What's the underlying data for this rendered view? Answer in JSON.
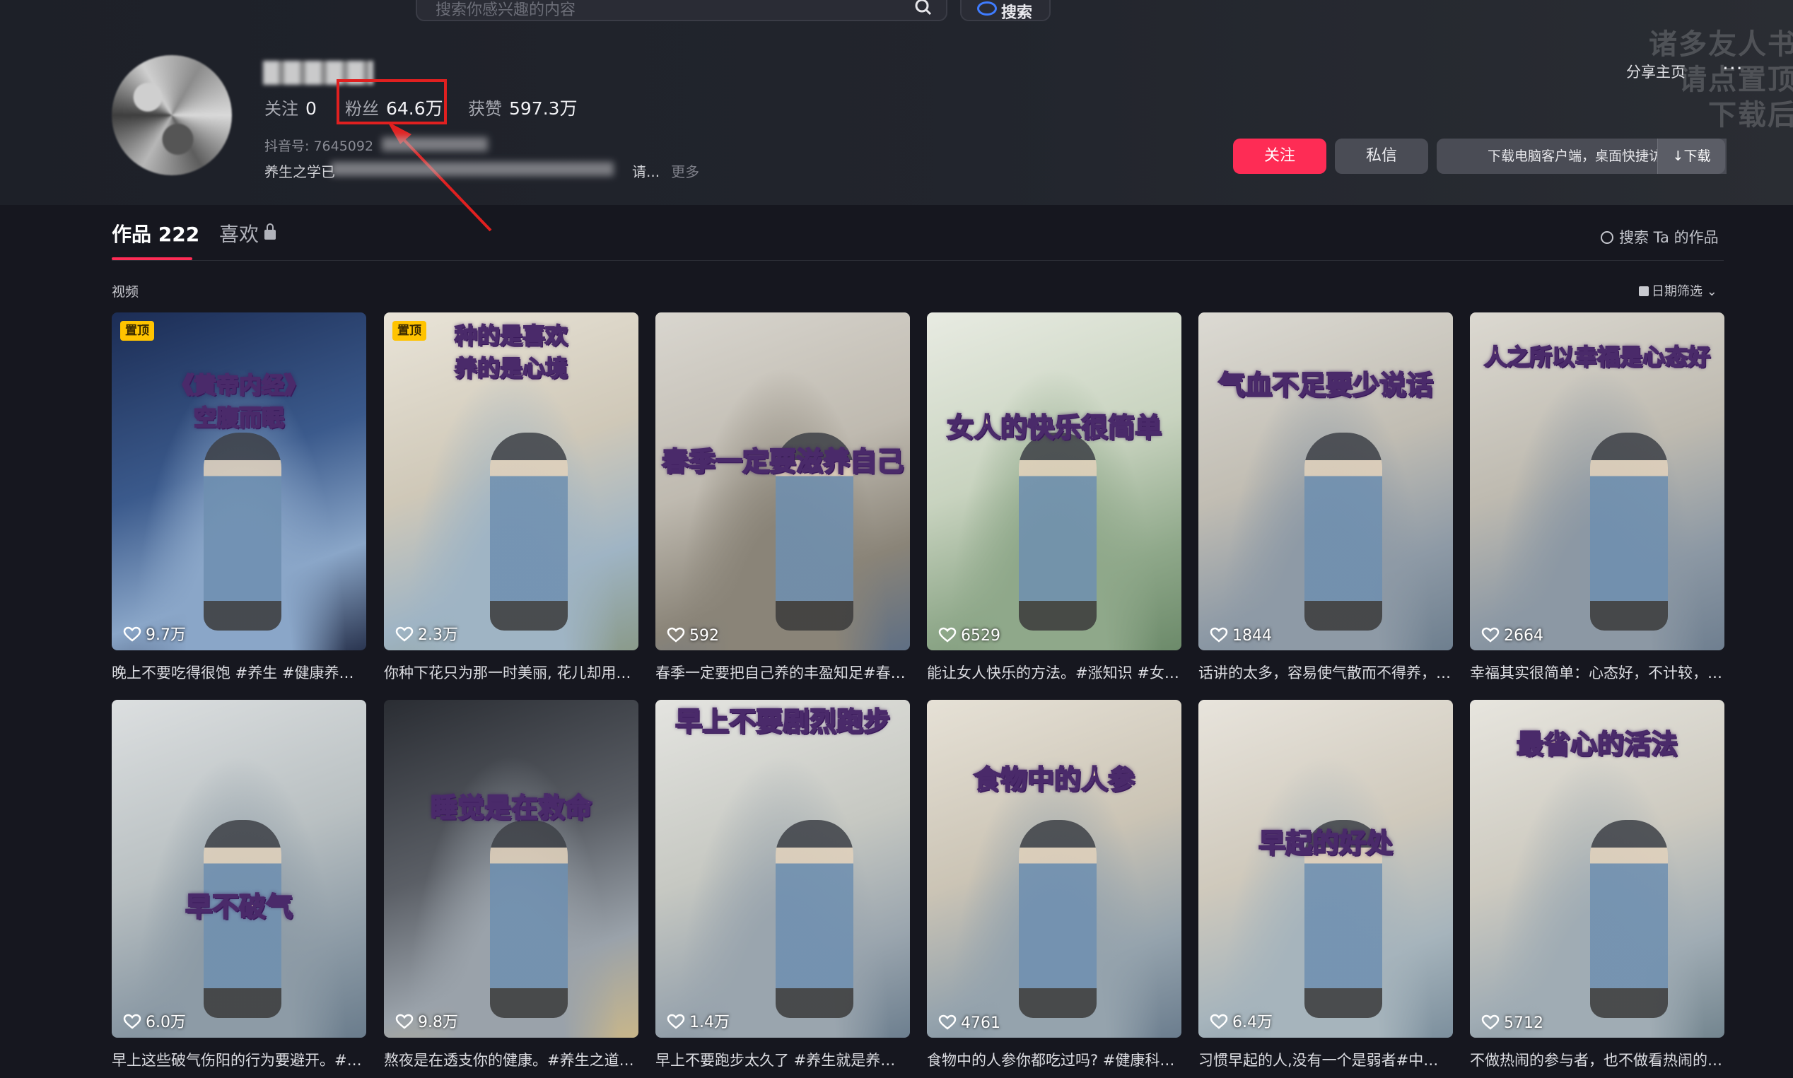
{
  "header": {
    "search_placeholder": "搜索你感兴趣的内容",
    "ai_search_label": "搜索",
    "watermark_lines": [
      "诸多友人书",
      "请点置顶",
      "下载后"
    ],
    "share_label": "分享主页",
    "more_label": "···"
  },
  "profile": {
    "stats": [
      {
        "label": "关注",
        "value": "0"
      },
      {
        "label": "粉丝",
        "value": "64.6万"
      },
      {
        "label": "获赞",
        "value": "597.3万"
      }
    ],
    "douyin_id_label": "抖音号: 7645092",
    "bio_start": "养生之学已",
    "bio_end": "请...",
    "more_label": "更多"
  },
  "actions": {
    "follow": "关注",
    "message": "私信",
    "download_tip": "下载电脑客户端，桌面快捷访问",
    "download": "↓下载"
  },
  "tabs": {
    "works": "作品 222",
    "likes": "喜欢",
    "search_works": "搜索 Ta 的作品",
    "section_label": "视频",
    "date_filter": "日期筛选"
  },
  "videos": [
    {
      "title": "《黄帝内经》\n空腹而眠",
      "likes": "9.7万",
      "pinned": true,
      "caption": "晚上不要吃得很饱 #养生 #健康养生 …"
    },
    {
      "title": "种的是喜欢\n养的是心境",
      "likes": "2.3万",
      "pinned": true,
      "caption": "你种下花只为那一时美丽, 花儿却用…"
    },
    {
      "title": "春季一定要滋养自己",
      "likes": "592",
      "pinned": false,
      "caption": "春季一定要把自己养的丰盈知足#春…"
    },
    {
      "title": "女人的快乐很简单",
      "likes": "6529",
      "pinned": false,
      "caption": "能让女人快乐的方法。#涨知识 #女…"
    },
    {
      "title": "气血不足要少说话",
      "likes": "1844",
      "pinned": false,
      "caption": "话讲的太多，容易使气散而不得养，…"
    },
    {
      "title": "人之所以幸福是心态好",
      "likes": "2664",
      "pinned": false,
      "caption": "幸福其实很简单：心态好，不计较，…"
    },
    {
      "title": "早不破气",
      "likes": "6.0万",
      "pinned": false,
      "caption": "早上这些破气伤阳的行为要避开。#…"
    },
    {
      "title": "睡觉是在救命",
      "likes": "9.8万",
      "pinned": false,
      "caption": "熬夜是在透支你的健康。#养生之道 …"
    },
    {
      "title": "早上不要剧烈跑步",
      "likes": "1.4万",
      "pinned": false,
      "caption": "早上不要跑步太久了 #养生就是养健…"
    },
    {
      "title": "食物中的人参",
      "likes": "4761",
      "pinned": false,
      "caption": "食物中的人参你都吃过吗? #健康科…"
    },
    {
      "title": "早起的好处",
      "likes": "6.4万",
      "pinned": false,
      "caption": "习惯早起的人,没有一个是弱者#中式…"
    },
    {
      "title": "最省心的活法",
      "likes": "5712",
      "pinned": false,
      "caption": "不做热闹的参与者，也不做看热闹的…"
    }
  ],
  "pin_label": "置顶"
}
